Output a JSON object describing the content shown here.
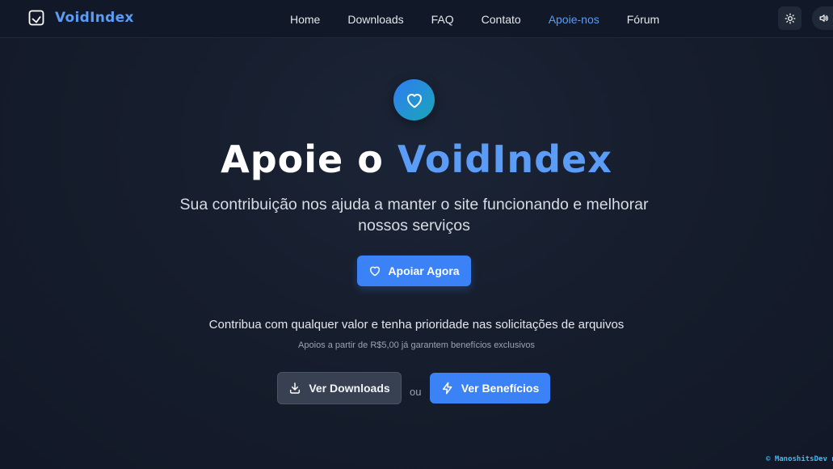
{
  "brand": {
    "name": "VoidIndex",
    "icon": "inbox-icon",
    "color": "#5b9cf6"
  },
  "nav": {
    "items": [
      {
        "label": "Home",
        "active": false
      },
      {
        "label": "Downloads",
        "active": false
      },
      {
        "label": "FAQ",
        "active": false
      },
      {
        "label": "Contato",
        "active": false
      },
      {
        "label": "Apoie-nos",
        "active": true
      },
      {
        "label": "Fórum",
        "active": false
      }
    ],
    "theme_icon": "sun-icon",
    "sound_icon": "volume-icon"
  },
  "hero": {
    "icon": "heart-icon",
    "title_main": "Apoie o ",
    "title_accent": "VoidIndex",
    "subtitle": "Sua contribuição nos ajuda a manter o site funcionando e melhorar nossos serviços",
    "cta_label": "Apoiar Agora",
    "cta_icon": "heart-icon"
  },
  "contribution": {
    "text": "Contribua com qualquer valor e tenha prioridade nas solicitações de arquivos",
    "note": "Apoios a partir de R$5,00 já garantem benefícios exclusivos"
  },
  "actions": {
    "downloads_label": "Ver Downloads",
    "downloads_icon": "download-icon",
    "or_text": "ou",
    "benefits_label": "Ver Benefícios",
    "benefits_icon": "lightning-icon"
  },
  "footer": {
    "credit": "© ManoshitsDev n"
  },
  "colors": {
    "accent": "#3b82f6",
    "background": "#151c2b",
    "header": "#111827"
  }
}
